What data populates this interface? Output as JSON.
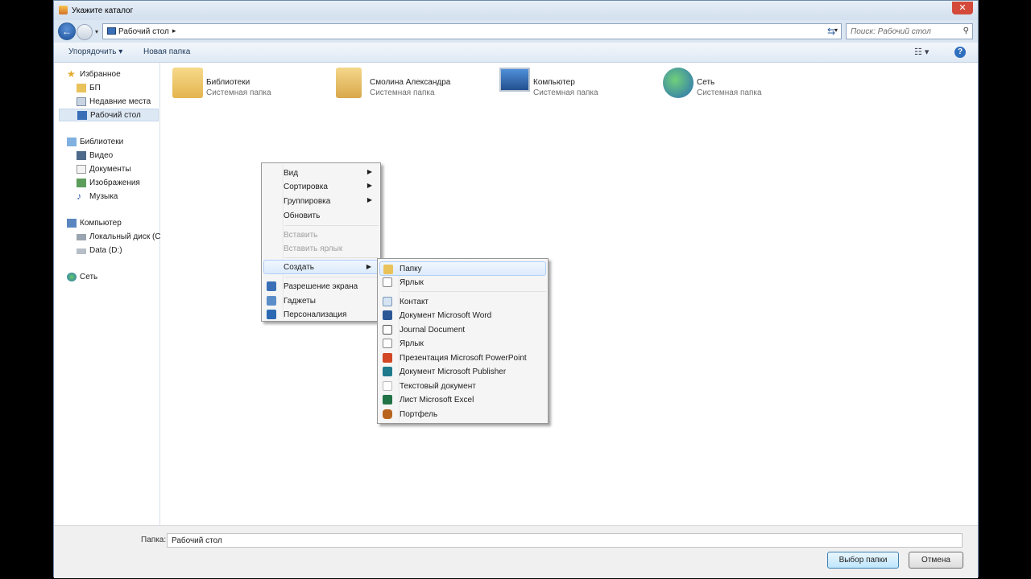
{
  "window": {
    "title": "Укажите каталог",
    "close_glyph": "✕"
  },
  "address": {
    "path": "Рабочий стол",
    "separator": "▸",
    "dropdown": "▾",
    "search_placeholder": "Поиск: Рабочий стол"
  },
  "toolbar": {
    "organize": "Упорядочить ▾",
    "new_folder": "Новая папка",
    "help": "?"
  },
  "sidebar": {
    "items": [
      {
        "label": "Избранное",
        "icon": "star-icon"
      },
      {
        "label": "БП",
        "icon": "folder-icon"
      },
      {
        "label": "Недавние места",
        "icon": "recent-places-icon"
      },
      {
        "label": "Рабочий стол",
        "icon": "desktop-icon"
      },
      {
        "label": "Библиотеки",
        "icon": "libraries-icon"
      },
      {
        "label": "Видео",
        "icon": "video-icon"
      },
      {
        "label": "Документы",
        "icon": "documents-icon"
      },
      {
        "label": "Изображения",
        "icon": "images-icon"
      },
      {
        "label": "Музыка",
        "icon": "music-icon"
      },
      {
        "label": "Компьютер",
        "icon": "computer-icon"
      },
      {
        "label": "Локальный диск (C",
        "icon": "drive-icon"
      },
      {
        "label": "Data (D:)",
        "icon": "drive-icon"
      },
      {
        "label": "Сеть",
        "icon": "network-icon"
      }
    ]
  },
  "tiles": [
    {
      "name": "Библиотеки",
      "type": "Системная папка"
    },
    {
      "name": "Смолина Александра",
      "type": "Системная папка"
    },
    {
      "name": "Компьютер",
      "type": "Системная папка"
    },
    {
      "name": "Сеть",
      "type": "Системная папка"
    }
  ],
  "context_menu": {
    "items": [
      {
        "label": "Вид"
      },
      {
        "label": "Сортировка"
      },
      {
        "label": "Группировка"
      },
      {
        "label": "Обновить"
      },
      {
        "label": "Вставить"
      },
      {
        "label": "Вставить ярлык"
      },
      {
        "label": "Создать"
      },
      {
        "label": "Разрешение экрана"
      },
      {
        "label": "Гаджеты"
      },
      {
        "label": "Персонализация"
      }
    ],
    "submenu_arrow": "▶"
  },
  "submenu": {
    "items": [
      {
        "label": "Папку"
      },
      {
        "label": "Ярлык"
      },
      {
        "label": "Контакт"
      },
      {
        "label": "Документ Microsoft Word"
      },
      {
        "label": "Journal Document"
      },
      {
        "label": "Ярлык"
      },
      {
        "label": "Презентация Microsoft PowerPoint"
      },
      {
        "label": "Документ Microsoft Publisher"
      },
      {
        "label": "Текстовый документ"
      },
      {
        "label": "Лист Microsoft Excel"
      },
      {
        "label": "Портфель"
      }
    ]
  },
  "bottom": {
    "folder_label": "Папка:",
    "folder_value": "Рабочий стол",
    "select_button": "Выбор папки",
    "cancel_button": "Отмена"
  },
  "colors": {
    "accent": "#2f6fbf",
    "window_border": "#6f8aa6"
  }
}
